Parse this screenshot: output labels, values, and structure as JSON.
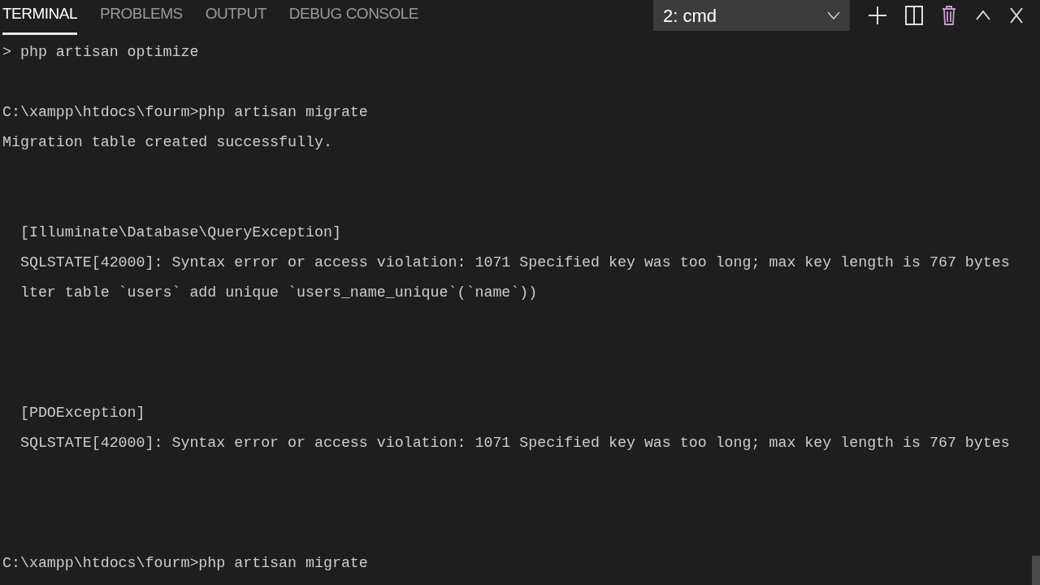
{
  "tabs": [
    {
      "label": "TERMINAL",
      "selected": true
    },
    {
      "label": "PROBLEMS",
      "selected": false
    },
    {
      "label": "OUTPUT",
      "selected": false
    },
    {
      "label": "DEBUG CONSOLE",
      "selected": false
    }
  ],
  "terminal_select": {
    "value": "2: cmd"
  },
  "lines": [
    {
      "kind": "text",
      "text": "> php artisan optimize"
    },
    {
      "kind": "blank"
    },
    {
      "kind": "text",
      "text": "C:\\xampp\\htdocs\\fourm>php artisan migrate"
    },
    {
      "kind": "text",
      "text": "Migration table created successfully."
    },
    {
      "kind": "blank"
    },
    {
      "kind": "blank"
    },
    {
      "kind": "text",
      "text": "  [Illuminate\\Database\\QueryException]"
    },
    {
      "kind": "text",
      "text": "  SQLSTATE[42000]: Syntax error or access violation: 1071 Specified key was too long; max key length is 767 bytes"
    },
    {
      "kind": "text",
      "text": "  lter table `users` add unique `users_name_unique`(`name`))"
    },
    {
      "kind": "blank"
    },
    {
      "kind": "blank"
    },
    {
      "kind": "blank"
    },
    {
      "kind": "text",
      "text": "  [PDOException]"
    },
    {
      "kind": "text",
      "text": "  SQLSTATE[42000]: Syntax error or access violation: 1071 Specified key was too long; max key length is 767 bytes"
    },
    {
      "kind": "blank"
    },
    {
      "kind": "blank"
    },
    {
      "kind": "blank"
    },
    {
      "kind": "text",
      "text": "C:\\xampp\\htdocs\\fourm>php artisan migrate"
    }
  ]
}
